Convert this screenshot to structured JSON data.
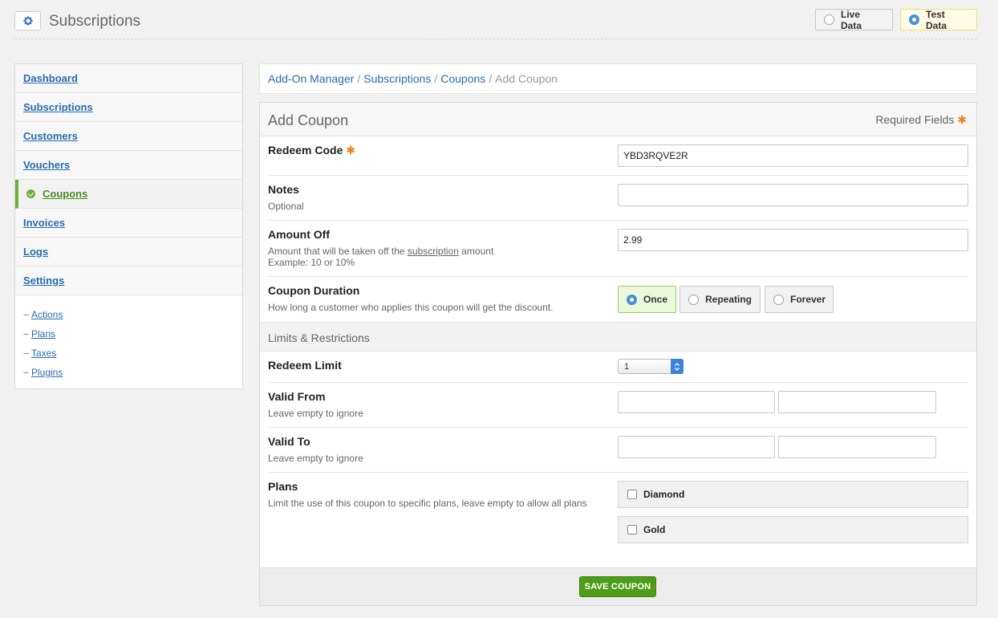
{
  "header": {
    "title": "Subscriptions",
    "live_label": "Live Data",
    "test_label": "Test Data"
  },
  "sidebar": {
    "items": [
      {
        "label": "Dashboard"
      },
      {
        "label": "Subscriptions"
      },
      {
        "label": "Customers"
      },
      {
        "label": "Vouchers"
      },
      {
        "label": "Coupons"
      },
      {
        "label": "Invoices"
      },
      {
        "label": "Logs"
      },
      {
        "label": "Settings"
      }
    ],
    "sub_items": [
      {
        "label": "Actions"
      },
      {
        "label": "Plans"
      },
      {
        "label": "Taxes"
      },
      {
        "label": "Plugins"
      }
    ]
  },
  "breadcrumb": {
    "items": [
      "Add-On Manager",
      "Subscriptions",
      "Coupons"
    ],
    "current": "Add Coupon",
    "separator": "/"
  },
  "form": {
    "title": "Add Coupon",
    "required_note": "Required Fields",
    "required_mark": "✱",
    "redeem_code": {
      "label": "Redeem Code",
      "value": "YBD3RQVE2R"
    },
    "notes": {
      "label": "Notes",
      "help": "Optional",
      "value": ""
    },
    "amount_off": {
      "label": "Amount Off",
      "help_pre": "Amount that will be taken off the ",
      "help_link": "subscription",
      "help_post": " amount",
      "help_example": "Example: 10 or 10%",
      "value": "2.99"
    },
    "duration": {
      "label": "Coupon Duration",
      "help": "How long a customer who applies this coupon will get the discount.",
      "options": [
        "Once",
        "Repeating",
        "Forever"
      ],
      "selected": "Once"
    },
    "section_title": "Limits & Restrictions",
    "redeem_limit": {
      "label": "Redeem Limit",
      "value": "1"
    },
    "valid_from": {
      "label": "Valid From",
      "help": "Leave empty to ignore"
    },
    "valid_to": {
      "label": "Valid To",
      "help": "Leave empty to ignore"
    },
    "plans": {
      "label": "Plans",
      "help": "Limit the use of this coupon to specific plans, leave empty to allow all plans",
      "options": [
        "Diamond",
        "Gold"
      ]
    },
    "save_label": "SAVE COUPON"
  },
  "colors": {
    "accent_blue": "#2b6cb0",
    "active_green": "#6fae3c",
    "save_green": "#4e9d19",
    "required_orange": "#f07c1b"
  }
}
